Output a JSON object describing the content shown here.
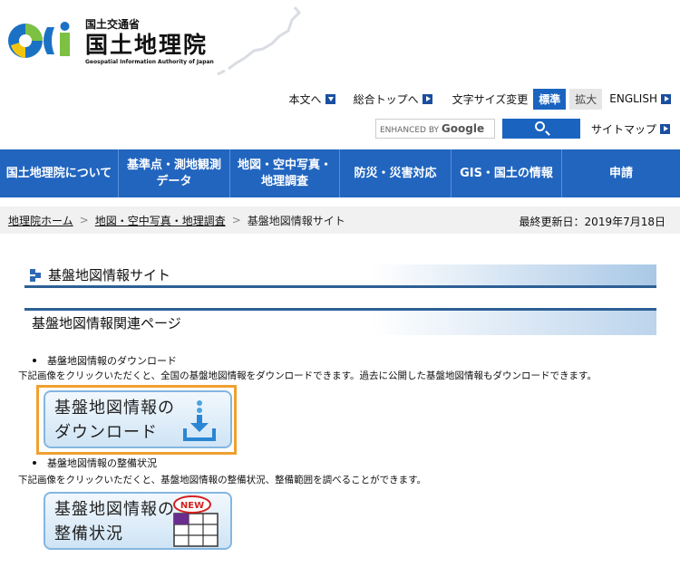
{
  "header": {
    "logo_ministry": "国土交通省",
    "logo_name": "国土地理院",
    "logo_en": "Geospatial Information Authority of Japan"
  },
  "utility": {
    "skip_to_content": "本文へ",
    "top": "総合トップへ",
    "font_size_label": "文字サイズ変更",
    "font_standard": "標準",
    "font_large": "拡大",
    "english": "ENGLISH",
    "search_enhanced": "ENHANCED BY",
    "search_google": "Google",
    "sitemap": "サイトマップ"
  },
  "nav": {
    "items": [
      {
        "label": "国土地理院について"
      },
      {
        "label": "基準点・測地観測データ"
      },
      {
        "label": "地図・空中写真・地理調査"
      },
      {
        "label": "防災・災害対応"
      },
      {
        "label": "GIS・国土の情報"
      },
      {
        "label": "申請"
      }
    ]
  },
  "breadcrumb": {
    "home": "地理院ホーム",
    "level2": "地図・空中写真・地理調査",
    "current": "基盤地図情報サイト",
    "separator": ">",
    "updated": "最終更新日：2019年7月18日"
  },
  "page": {
    "title": "基盤地図情報サイト",
    "section_title": "基盤地図情報関連ページ",
    "item1_label": "基盤地図情報のダウンロード",
    "item1_desc": "下記画像をクリックいただくと、全国の基盤地図情報をダウンロードできます。過去に公開した基盤地図情報もダウンロードできます。",
    "banner1_line1": "基盤地図情報の",
    "banner1_line2": "ダウンロード",
    "item2_label": "基盤地図情報の整備状況",
    "item2_desc": "下記画像をクリックいただくと、基盤地図情報の整備状況、整備範囲を調べることができます。",
    "banner2_line1": "基盤地図情報の",
    "banner2_line2": "整備状況",
    "new_badge": "NEW"
  },
  "colors": {
    "nav_bg": "#2165bf",
    "accent_blue": "#1a64c0",
    "focus_orange": "#f0a030",
    "banner_border": "#85b6e0"
  }
}
